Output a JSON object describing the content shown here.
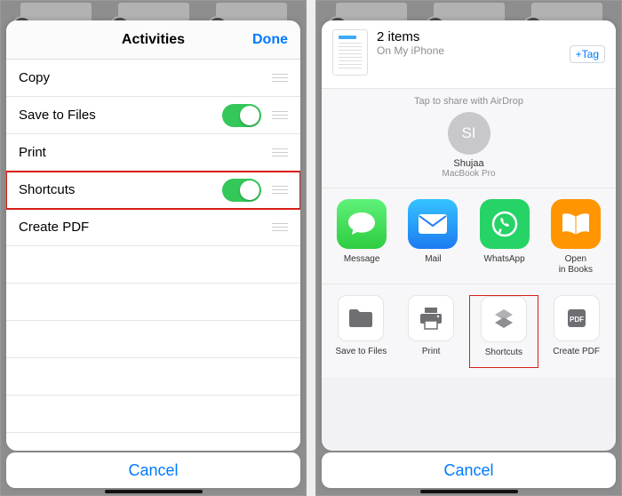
{
  "left": {
    "title": "Activities",
    "done": "Done",
    "rows": [
      {
        "label": "Copy",
        "toggle": false
      },
      {
        "label": "Save to Files",
        "toggle": true
      },
      {
        "label": "Print",
        "toggle": false
      },
      {
        "label": "Shortcuts",
        "toggle": true,
        "highlight": true
      },
      {
        "label": "Create PDF",
        "toggle": false
      }
    ],
    "cancel": "Cancel"
  },
  "right": {
    "header": {
      "count_label": "2 items",
      "location": "On My iPhone",
      "tag": "+Tag"
    },
    "airdrop": {
      "hint": "Tap to share with AirDrop",
      "contact": {
        "initials": "SI",
        "name": "Shujaa",
        "device": "MacBook Pro"
      }
    },
    "apps": [
      {
        "label": "Message",
        "kind": "message"
      },
      {
        "label": "Mail",
        "kind": "mail"
      },
      {
        "label": "WhatsApp",
        "kind": "whatsapp"
      },
      {
        "label": "Open\nin Books",
        "kind": "books"
      }
    ],
    "actions": [
      {
        "label": "Save to Files",
        "kind": "folder"
      },
      {
        "label": "Print",
        "kind": "print"
      },
      {
        "label": "Shortcuts",
        "kind": "shortcuts",
        "highlight": true
      },
      {
        "label": "Create PDF",
        "kind": "pdf"
      }
    ],
    "cancel": "Cancel"
  }
}
